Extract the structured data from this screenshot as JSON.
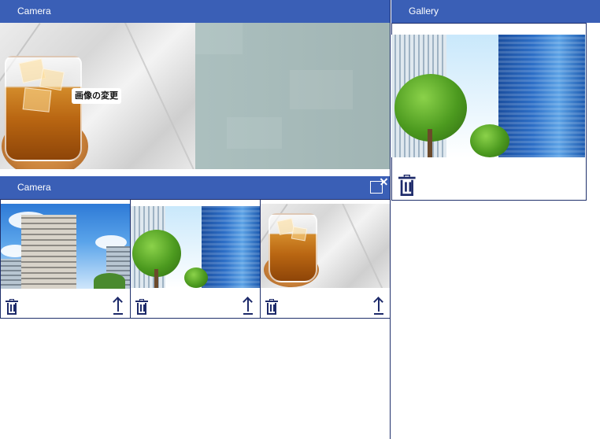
{
  "camera_panel": {
    "title": "Camera",
    "overlay_label": "画像の変更"
  },
  "gallery_panel": {
    "title": "Gallery"
  },
  "camera_gallery": {
    "title": "Camera",
    "items": [
      {
        "image": "apartment-building-photo"
      },
      {
        "image": "glass-tower-with-trees-photo"
      },
      {
        "image": "whisky-glass-on-marble-photo"
      }
    ]
  },
  "colors": {
    "header": "#3a5fb6",
    "icon": "#1d2a6a",
    "border": "#1f2f6b"
  },
  "icons": {
    "delete": "trash-icon",
    "upload": "upload-arrow-icon",
    "expand": "expand-close-icon"
  }
}
